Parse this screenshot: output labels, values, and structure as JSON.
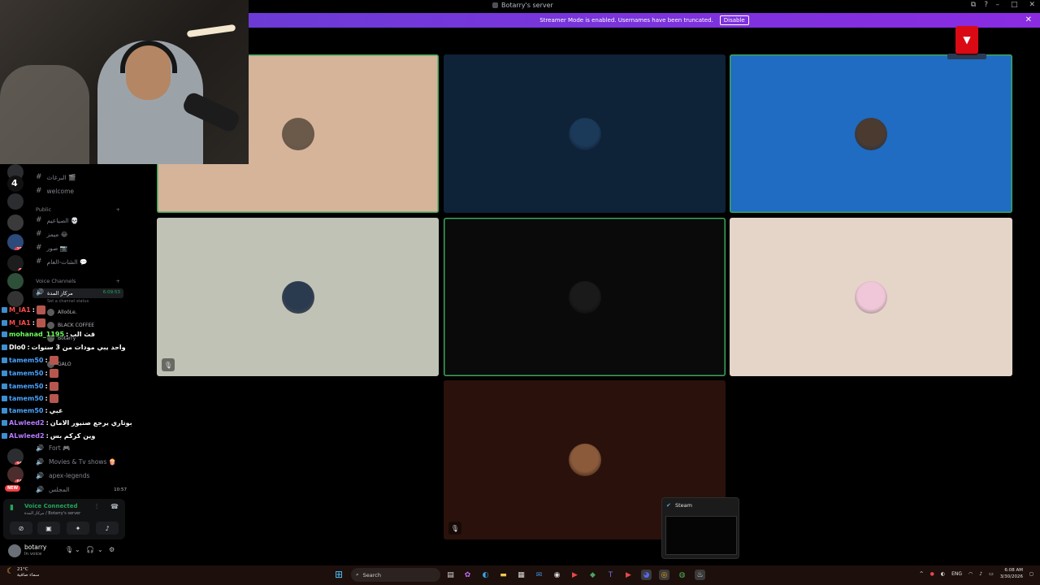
{
  "window": {
    "title": "Botarry's server"
  },
  "banner": {
    "text": "Streamer Mode is enabled. Usernames have been truncated.",
    "disable_label": "Disable",
    "close": "✕"
  },
  "sidebar": {
    "channels": [
      {
        "name": "البرغاث 🎬",
        "type": "text"
      },
      {
        "name": "welcome",
        "type": "text"
      }
    ],
    "public_category": "Public",
    "public_channels": [
      {
        "name": "الصياعيم 💀"
      },
      {
        "name": "ميمز 😂"
      },
      {
        "name": "صور 📷"
      },
      {
        "name": "الشات-العام 💬"
      }
    ],
    "voice_category": "Voice Channels",
    "active_voice": {
      "name": "مركاز المدة",
      "time": "6:09:53",
      "status_hint": "Set a channel status"
    },
    "voice_members": [
      {
        "name": "AlloôLe."
      },
      {
        "name": "BLACK COFFEE"
      },
      {
        "name": "Botarry"
      },
      {
        "name": "GALO"
      }
    ],
    "voice_channels_bottom": [
      {
        "name": "Fort 🎮"
      },
      {
        "name": "Movies & Tv shows 🍿"
      },
      {
        "name": "apex-legends"
      },
      {
        "name": "المجلس",
        "time": "10:57"
      }
    ],
    "guild_badges": [
      "3",
      "4",
      "100",
      "90",
      "946",
      "641"
    ],
    "new_badge": "NEW"
  },
  "chat": [
    {
      "user": "M_IA1",
      "color": "#ff4a4a",
      "sep": ":",
      "msg": ""
    },
    {
      "user": "M_IA1",
      "color": "#ff4a4a",
      "sep": ":",
      "msg": ""
    },
    {
      "user": "mohanad_1195",
      "color": "#6dff5a",
      "sep": ":",
      "msg": "قث الب"
    },
    {
      "user": "Dlo0",
      "color": "#ffffff",
      "sep": ":",
      "msg": "واحد يبي مودات من 3 سنوات"
    },
    {
      "user": "tamem50",
      "color": "#4aa3ff",
      "sep": ":",
      "msg": ""
    },
    {
      "user": "tamem50",
      "color": "#4aa3ff",
      "sep": ":",
      "msg": ""
    },
    {
      "user": "tamem50",
      "color": "#4aa3ff",
      "sep": ":",
      "msg": ""
    },
    {
      "user": "tamem50",
      "color": "#4aa3ff",
      "sep": ":",
      "msg": ""
    },
    {
      "user": "tamem50",
      "color": "#4aa3ff",
      "sep": ":",
      "msg": "غبي"
    },
    {
      "user": "ALwleed2",
      "color": "#b77bff",
      "sep": ":",
      "msg": "بوتاري يرجع صنيور الامان"
    },
    {
      "user": "ALwleed2",
      "color": "#b77bff",
      "sep": ":",
      "msg": "وين كركم بس"
    }
  ],
  "voice_panel": {
    "status": "Voice Connected",
    "sub": "مركاز المدة / Botarry's server"
  },
  "user_panel": {
    "name": "botarry",
    "status": "In voice"
  },
  "tiles": [
    {
      "bg": "#d5b49a",
      "avatar": "#6b5a4a",
      "speaking": true,
      "muted": false
    },
    {
      "bg": "#0e2238",
      "avatar": "#1b3a5a",
      "speaking": false,
      "muted": false
    },
    {
      "bg": "#1f6cc2",
      "avatar": "#4b3a30",
      "speaking": true,
      "muted": false
    },
    {
      "bg": "#bfc2b5",
      "avatar": "#2a3a4f",
      "speaking": false,
      "muted": true
    },
    {
      "bg": "#0a0a0a",
      "avatar": "#1a1a1a",
      "speaking": true,
      "muted": false
    },
    {
      "bg": "#e4d5c8",
      "avatar": "#f0c7d8",
      "speaking": false,
      "muted": false
    },
    {
      "bg": "#2a110c",
      "avatar": "#8a5a3a",
      "speaking": false,
      "muted": true
    }
  ],
  "steam_popup": {
    "title": "Steam"
  },
  "taskbar": {
    "weather_temp": "21°C",
    "weather_desc": "سماء صافية",
    "search_placeholder": "Search",
    "lang": "ENG",
    "time": "6:08 AM",
    "date": "3/30/2026"
  }
}
